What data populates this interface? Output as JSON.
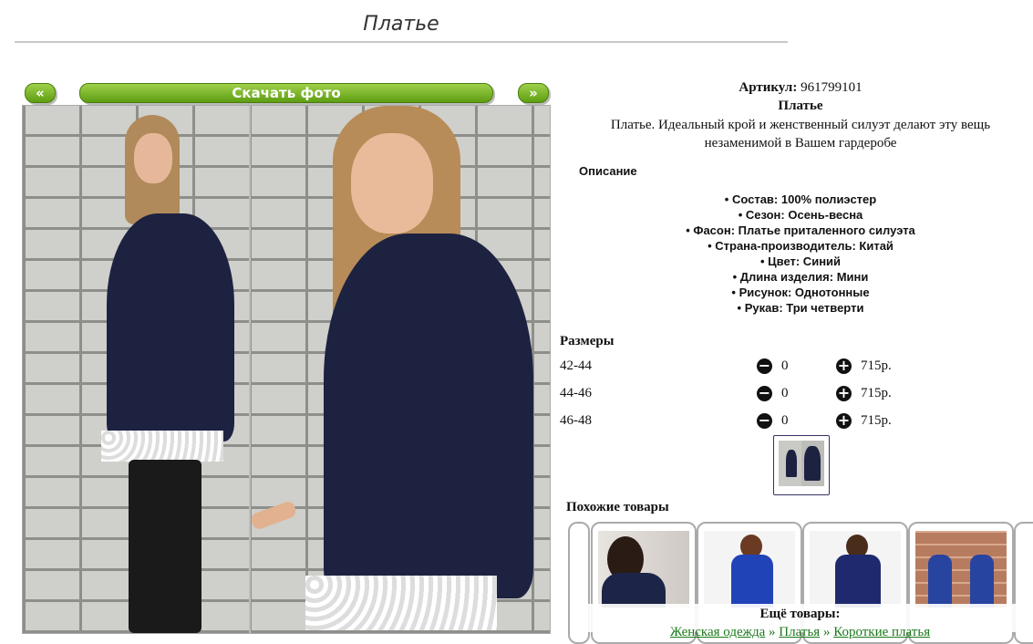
{
  "page_title": "Платье",
  "gallery": {
    "prev_label": "«",
    "download_label": "Скачать фото",
    "next_label": "»"
  },
  "product": {
    "article_label": "Артикул:",
    "article_value": "961799101",
    "name": "Платье",
    "description": "Платье. Идеальный крой и женственный силуэт делают эту вещь незаменимой в Вашем гардеробе",
    "description_title": "Описание",
    "specs": [
      "Состав: 100% полиэстер",
      "Сезон: Осень-весна",
      "Фасон: Платье приталенного силуэта",
      "Страна-производитель: Китай",
      "Цвет: Синий",
      "Длина изделия: Мини",
      "Рисунок: Однотонные",
      "Рукав: Три четверти"
    ]
  },
  "sizes": {
    "title": "Размеры",
    "rows": [
      {
        "size": "42-44",
        "qty": "0",
        "price": "715р."
      },
      {
        "size": "44-46",
        "qty": "0",
        "price": "715р."
      },
      {
        "size": "46-48",
        "qty": "0",
        "price": "715р."
      }
    ]
  },
  "similar": {
    "title": "Похожие товары"
  },
  "more": {
    "title": "Ещё товары:",
    "crumbs": [
      "Женская одежда",
      "Платья",
      "Короткие платья"
    ],
    "separator": " » "
  },
  "icons": {
    "minus": "minus-circle-icon",
    "plus": "plus-circle-icon"
  },
  "colors": {
    "button_green": "#6aab1a",
    "link_green": "#1a7a1a",
    "dress_navy": "#1d2241"
  }
}
